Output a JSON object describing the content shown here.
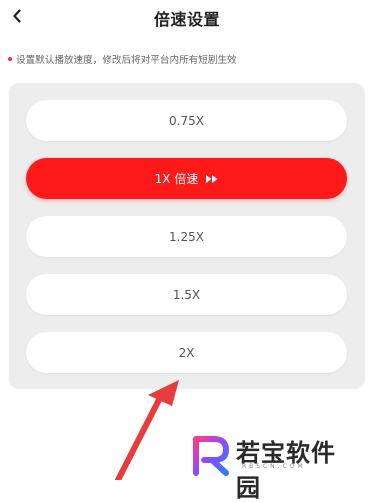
{
  "header": {
    "title": "倍速设置",
    "back_icon": "chevron-left-icon"
  },
  "notice": {
    "text": "设置默认播放速度，修改后将对平台内所有短剧生效",
    "dot_color": "#ff2d2d"
  },
  "speed_options": [
    {
      "label": "0.75X",
      "selected": false
    },
    {
      "label": "1X 倍速",
      "selected": true,
      "icon": "fast-forward-icon"
    },
    {
      "label": "1.25X",
      "selected": false
    },
    {
      "label": "1.5X",
      "selected": false
    },
    {
      "label": "2X",
      "selected": false
    }
  ],
  "watermark": {
    "brand": "若宝软件园",
    "url": "RBSCN.COM"
  },
  "colors": {
    "accent": "#ff1a1a",
    "panel": "#ededed",
    "annotation_arrow": "#e83b3b"
  }
}
